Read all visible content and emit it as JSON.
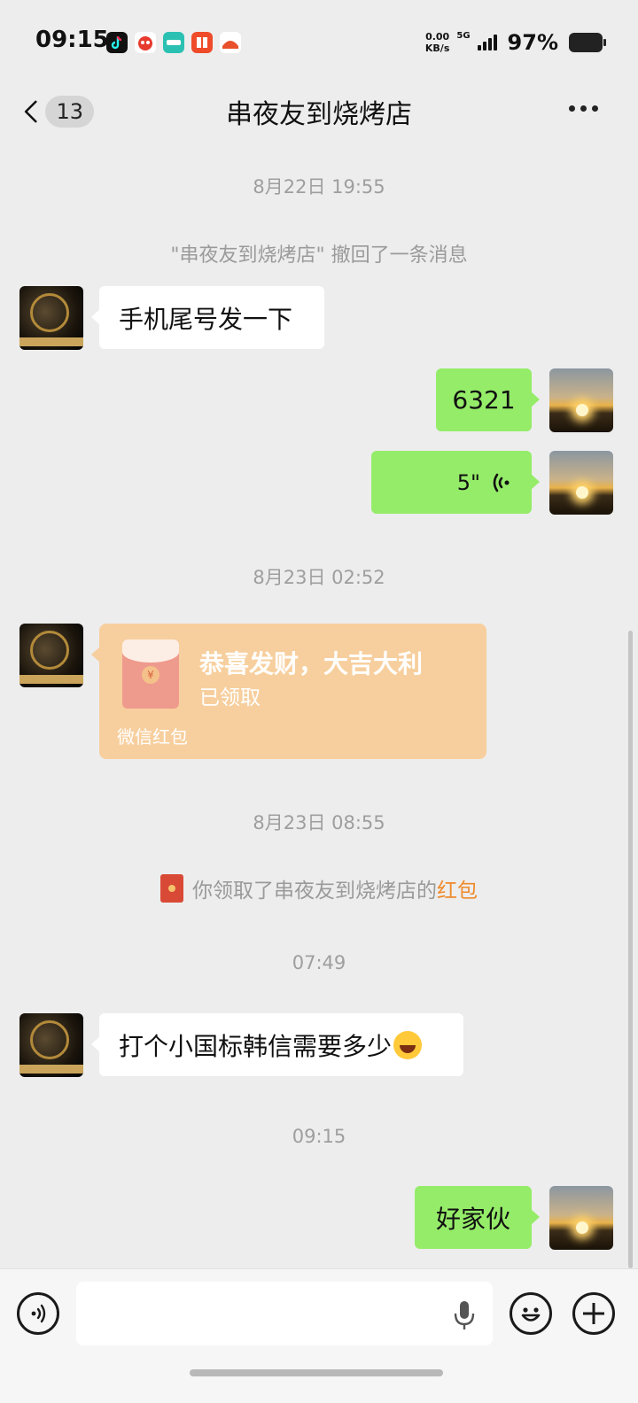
{
  "status_bar": {
    "time": "09:15",
    "apps": [
      {
        "icon": "tiktok-icon",
        "color": "#111111"
      },
      {
        "icon": "app-red-icon",
        "color": "#e73a2e"
      },
      {
        "icon": "boss-zhipin-icon",
        "color": "#2bc1b2"
      },
      {
        "icon": "ting-icon",
        "color": "#ef4b2a"
      },
      {
        "icon": "app-orange-icon",
        "color": "#e8502b"
      }
    ],
    "net_speed_value": "0.00",
    "net_speed_unit": "KB/s",
    "signal_label": "5G",
    "battery": "97%"
  },
  "header": {
    "back_count": "13",
    "title": "串夜友到烧烤店",
    "more_icon": "more-dots-icon"
  },
  "messages": {
    "ts1": "8月22日 19:55",
    "recall_notice": "\"串夜友到烧烤店\" 撤回了一条消息",
    "m1": "手机尾号发一下",
    "m2": "6321",
    "m3_voice_length": "5\"",
    "ts2": "8月23日 02:52",
    "red_packet": {
      "title": "恭喜发财，大吉大利",
      "status": "已领取",
      "footer": "微信红包",
      "color": "#f7cf9e"
    },
    "ts3": "8月23日 08:55",
    "claim_notice_prefix": "你领取了串夜友到烧烤店的",
    "claim_notice_link": "红包",
    "ts4": "07:49",
    "m4": "打个小国标韩信需要多少",
    "ts5": "09:15",
    "m5": "好家伙"
  },
  "input_bar": {
    "placeholder": "",
    "voice_toggle_icon": "voice-mode-icon",
    "mic_icon": "microphone-icon",
    "emoji_icon": "emoji-icon",
    "plus_icon": "plus-icon"
  },
  "colors": {
    "background": "#ededed",
    "bubble_out": "#95ec69",
    "bubble_in": "#ffffff",
    "link": "#ef8a2c"
  }
}
